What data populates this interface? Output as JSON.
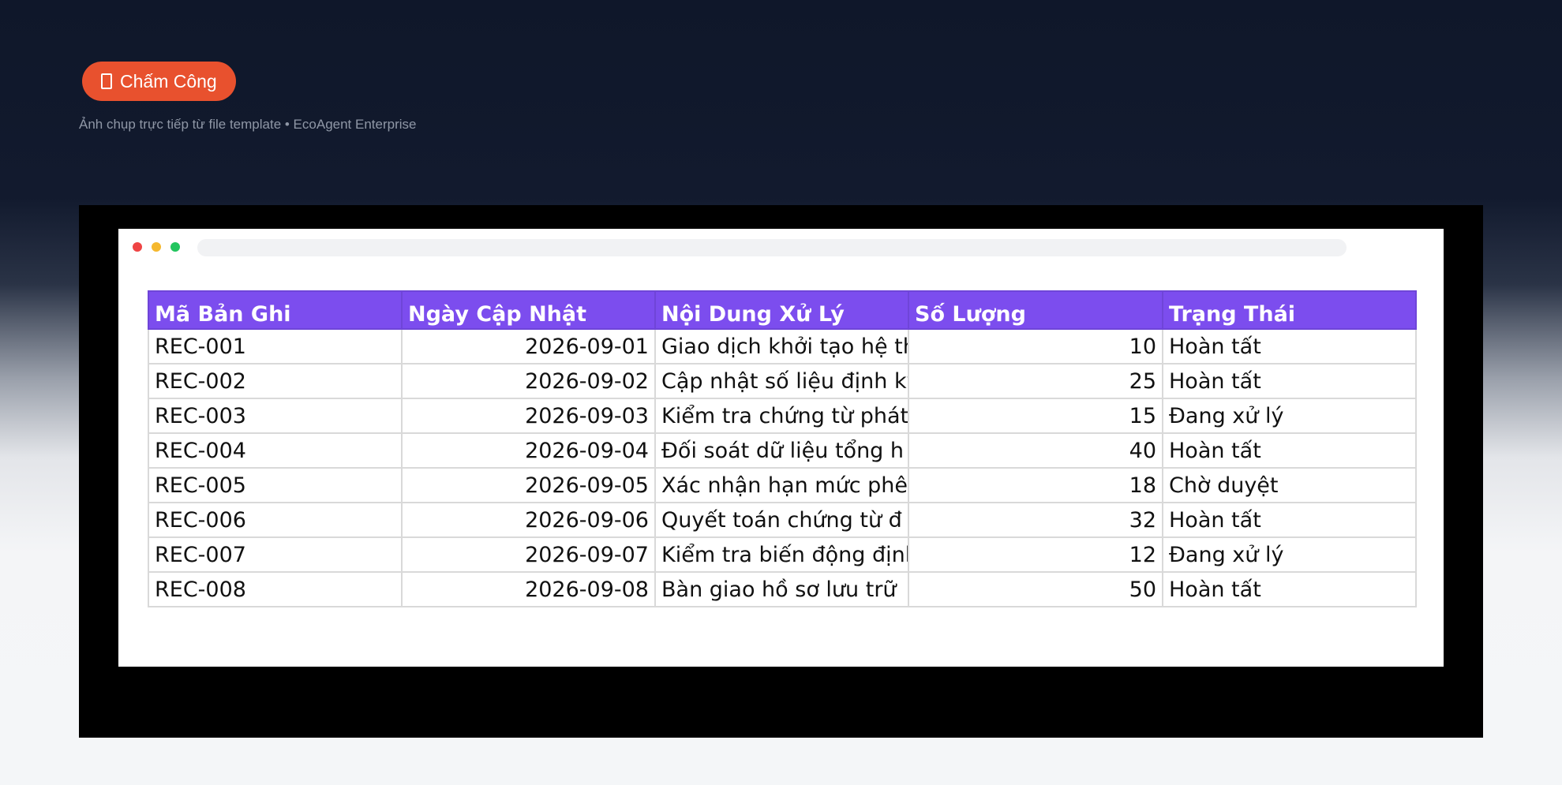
{
  "header": {
    "badge_label": "Chấm Công",
    "subtitle": "Ảnh chụp trực tiếp từ file template • EcoAgent Enterprise"
  },
  "table": {
    "columns": [
      "Mã Bản Ghi",
      "Ngày Cập Nhật",
      "Nội Dung Xử Lý",
      "Số Lượng",
      "Trạng Thái"
    ],
    "rows": [
      [
        "REC-001",
        "2026-09-01",
        "Giao dịch khởi tạo hệ th",
        "10",
        "Hoàn tất"
      ],
      [
        "REC-002",
        "2026-09-02",
        "Cập nhật số liệu định kỳ",
        "25",
        "Hoàn tất"
      ],
      [
        "REC-003",
        "2026-09-03",
        "Kiểm tra chứng từ phát",
        "15",
        "Đang xử lý"
      ],
      [
        "REC-004",
        "2026-09-04",
        "Đối soát dữ liệu tổng h",
        "40",
        "Hoàn tất"
      ],
      [
        "REC-005",
        "2026-09-05",
        "Xác nhận hạn mức phê",
        "18",
        "Chờ duyệt"
      ],
      [
        "REC-006",
        "2026-09-06",
        "Quyết toán chứng từ đ",
        "32",
        "Hoàn tất"
      ],
      [
        "REC-007",
        "2026-09-07",
        "Kiểm tra biến động định",
        "12",
        "Đang xử lý"
      ],
      [
        "REC-008",
        "2026-09-08",
        "Bàn giao hồ sơ lưu trữ",
        "50",
        "Hoàn tất"
      ]
    ]
  },
  "colors": {
    "badge": "#e8512e",
    "header_bg": "#7c4dee",
    "page_bg_top": "#0f172a"
  },
  "icons": {
    "badge_icon": "clipboard-icon"
  }
}
